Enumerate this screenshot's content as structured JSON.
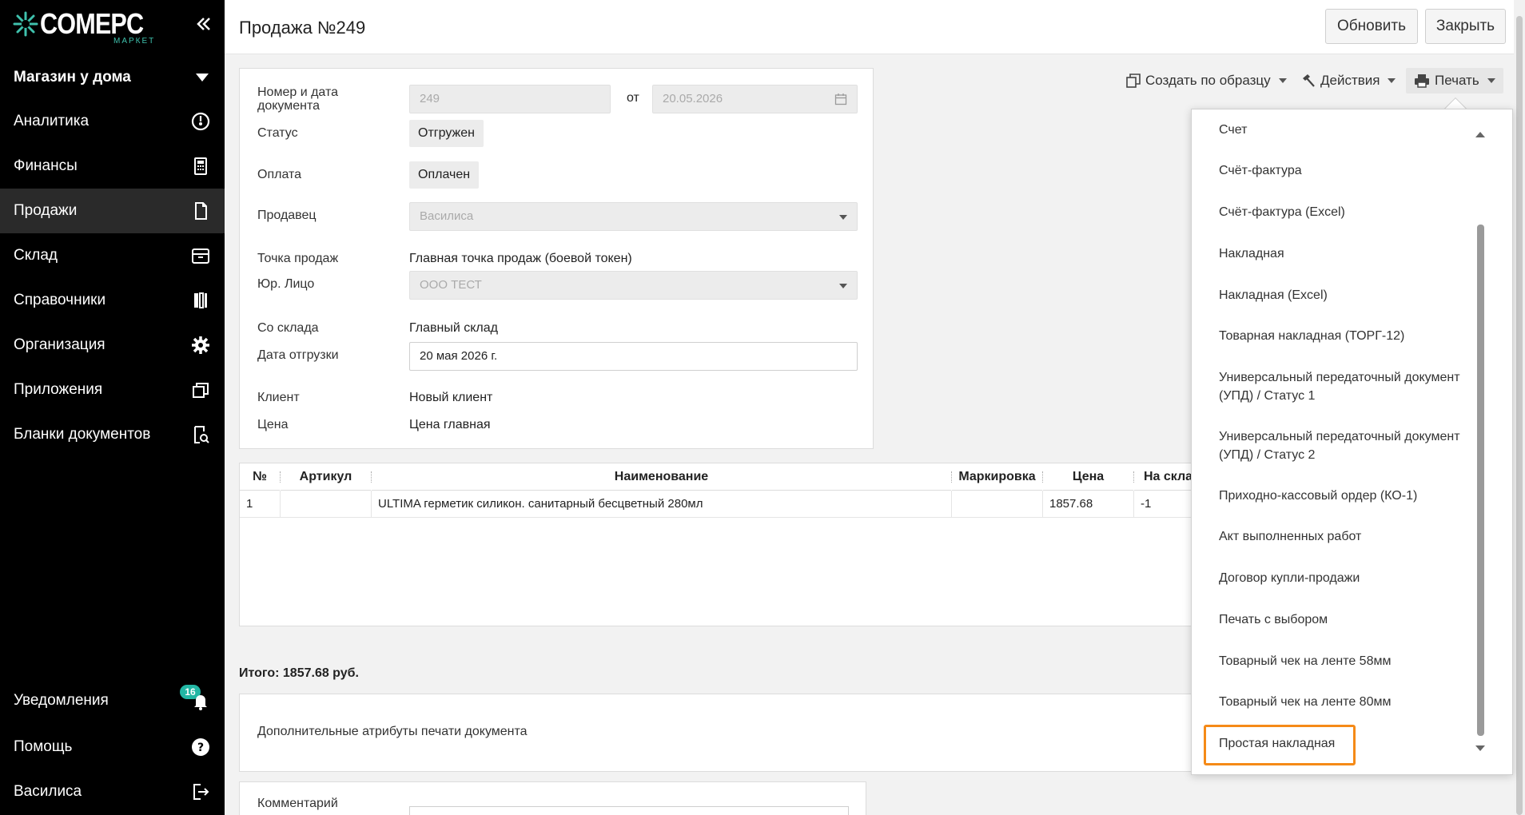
{
  "brand": {
    "name": "COMEPC",
    "sub": "МАРКЕТ",
    "accent": "#3fc1ad"
  },
  "store": {
    "name": "Магазин у дома"
  },
  "nav": [
    {
      "label": "Аналитика",
      "icon": "gauge-icon"
    },
    {
      "label": "Финансы",
      "icon": "calculator-icon"
    },
    {
      "label": "Продажи",
      "icon": "document-icon",
      "active": true
    },
    {
      "label": "Склад",
      "icon": "box-icon"
    },
    {
      "label": "Справочники",
      "icon": "books-icon"
    },
    {
      "label": "Организация",
      "icon": "gear-icon"
    },
    {
      "label": "Приложения",
      "icon": "windows-icon"
    },
    {
      "label": "Бланки документов",
      "icon": "search-document-icon"
    }
  ],
  "bottom_nav": {
    "notifications": {
      "label": "Уведомления",
      "badge": "16",
      "icon": "bell-icon"
    },
    "help": {
      "label": "Помощь",
      "icon": "help-icon"
    },
    "user": {
      "label": "Василиса",
      "icon": "logout-icon"
    }
  },
  "header": {
    "title": "Продажа №249",
    "refresh": "Обновить",
    "close": "Закрыть"
  },
  "toolbar": {
    "create_from": "Создать по образцу",
    "actions": "Действия",
    "print": "Печать"
  },
  "form": {
    "doc_label": "Номер и дата документа",
    "doc_number": "249",
    "from": "от",
    "doc_date": "20.05.2026",
    "status_label": "Статус",
    "status": "Отгружен",
    "payment_label": "Оплата",
    "payment": "Оплачен",
    "seller_label": "Продавец",
    "seller": "Василиса",
    "pos_label": "Точка продаж",
    "pos": "Главная точка продаж (боевой токен)",
    "entity_label": "Юр. Лицо",
    "entity": "ООО ТЕСТ",
    "warehouse_label": "Со склада",
    "warehouse": "Главный склад",
    "ship_date_label": "Дата отгрузки",
    "ship_date": "20 мая 2026 г.",
    "client_label": "Клиент",
    "client": "Новый клиент",
    "price_label": "Цена",
    "price": "Цена главная"
  },
  "table": {
    "headers": [
      "№",
      "Артикул",
      "Наименование",
      "Маркировка",
      "Цена",
      "На склад"
    ],
    "rows": [
      [
        "1",
        "",
        "ULTIMA герметик силикон. санитарный бесцветный 280мл",
        "",
        "1857.68",
        "-1"
      ]
    ]
  },
  "total": "Итого: 1857.68 руб.",
  "attributes_label": "Дополнительные атрибуты печати документа",
  "comment_label": "Комментарий",
  "print_menu": {
    "items": [
      "Счет",
      "Счёт-фактура",
      "Счёт-фактура (Excel)",
      "Накладная",
      "Накладная (Excel)",
      "Товарная накладная (ТОРГ-12)",
      "Универсальный передаточный документ (УПД) / Статус 1",
      "Универсальный передаточный документ (УПД) / Статус 2",
      "Приходно-кассовый ордер (КО-1)",
      "Акт выполненных работ",
      "Договор купли-продажи",
      "Печать с выбором",
      "Товарный чек на ленте 58мм",
      "Товарный чек на ленте 80мм",
      "Простая накладная"
    ],
    "highlighted": "Простая накладная",
    "highlight_color": "#f58a17"
  }
}
